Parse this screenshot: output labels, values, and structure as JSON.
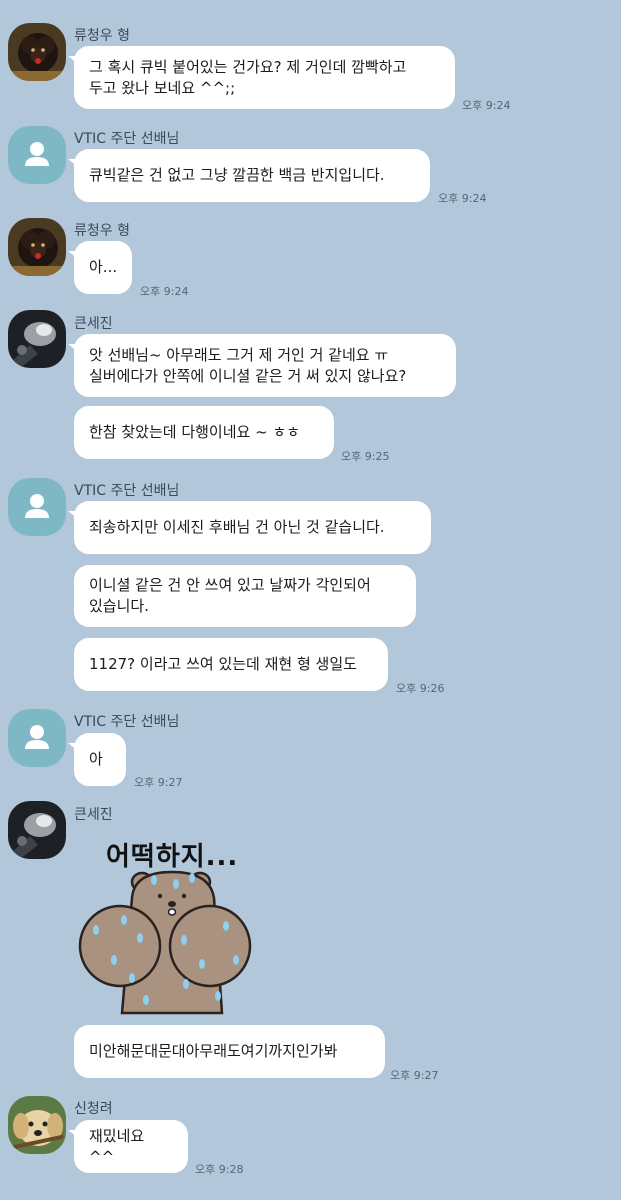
{
  "messages": [
    {
      "sender": "류청우 형",
      "bubbles": [
        "그 혹시 큐빅 붙어있는 건가요? 제 거인데 깜빡하고\n두고 왔나 보네요 ^^;;"
      ],
      "time": "오후 9:24"
    },
    {
      "sender": "VTIC 주단 선배님",
      "bubbles": [
        "큐빅같은 건 없고 그냥 깔끔한 백금 반지입니다."
      ],
      "time": "오후 9:24"
    },
    {
      "sender": "류청우 형",
      "bubbles": [
        "아..."
      ],
      "time": "오후 9:24"
    },
    {
      "sender": "큰세진",
      "bubbles": [
        "앗 선배님~ 아무래도 그거 제 거인 거 같네요 ㅠ\n실버에다가 안쪽에 이니셜 같은 거 써 있지 않나요?",
        "한참 찾았는데 다행이네요 ~ ㅎㅎ"
      ],
      "time": "오후 9:25"
    },
    {
      "sender": "VTIC 주단 선배님",
      "bubbles": [
        "죄송하지만 이세진 후배님 건 아닌 것 같습니다.",
        "이니셜 같은 건 안 쓰여 있고 날짜가 각인되어\n있습니다.",
        "1127? 이라고 쓰여 있는데 재현 형 생일도"
      ],
      "time": "오후 9:26"
    },
    {
      "sender": "VTIC 주단 선배님",
      "bubbles": [
        "아"
      ],
      "time": "오후 9:27"
    },
    {
      "sender": "큰세진",
      "sticker_text": "어떡하지...",
      "bubbles": [
        "미안해문대문대아무래도여기까지인가봐"
      ],
      "time": "오후 9:27"
    },
    {
      "sender": "신청려",
      "bubbles": [
        "재밌네요 ^^"
      ],
      "time": "오후 9:28"
    }
  ],
  "avatar_icons": [
    "dog-avatar-icon",
    "default-profile-icon",
    "dog-avatar-icon",
    "dark-photo-avatar-icon",
    "default-profile-icon",
    "default-profile-icon",
    "dark-photo-avatar-icon",
    "puppy-avatar-icon"
  ],
  "colors": {
    "background": "#b2c7da",
    "bubble": "#ffffff",
    "default_avatar": "#7fb8c5"
  }
}
